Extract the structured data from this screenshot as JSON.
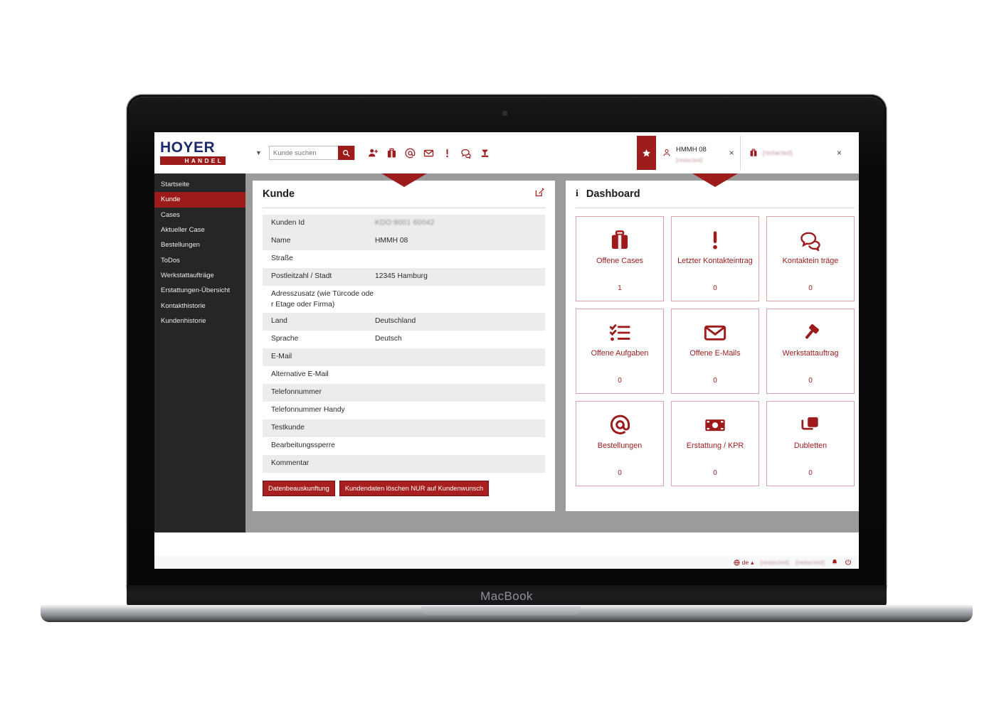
{
  "device": {
    "label": "MacBook"
  },
  "header": {
    "logo_primary": "HOYER",
    "logo_secondary": "HANDEL",
    "search": {
      "placeholder": "Kunde suchen",
      "value": ""
    },
    "icons": [
      "add-user-icon",
      "briefcase-icon",
      "at-sign-icon",
      "envelope-icon",
      "exclamation-icon",
      "chat-bubbles-icon",
      "gavel-icon"
    ],
    "tabs": [
      {
        "starred": true,
        "icon": "person-icon",
        "title": "HMMH 08",
        "subtitle": "[redacted]",
        "close": "×"
      },
      {
        "starred": false,
        "icon": "briefcase-icon",
        "title": "[redacted]",
        "subtitle": "",
        "close": "×"
      }
    ]
  },
  "sidebar": {
    "items": [
      {
        "label": "Startseite",
        "active": false
      },
      {
        "label": "Kunde",
        "active": true
      },
      {
        "label": "Cases",
        "active": false
      },
      {
        "label": "Aktueller Case",
        "active": false
      },
      {
        "label": "Bestellungen",
        "active": false
      },
      {
        "label": "ToDos",
        "active": false
      },
      {
        "label": "Werkstattaufträge",
        "active": false
      },
      {
        "label": "Erstattungen-Übersicht",
        "active": false
      },
      {
        "label": "Kontakthistorie",
        "active": false
      },
      {
        "label": "Kundenhistorie",
        "active": false
      }
    ]
  },
  "kunde_panel": {
    "title": "Kunde",
    "edit_icon": "edit-pencil-icon",
    "fields": [
      {
        "label": "Kunden Id",
        "value": "KDO:8001 60042",
        "blurred": true
      },
      {
        "label": "Name",
        "value": "HMMH 08",
        "blurred": false
      },
      {
        "label": "Straße",
        "value": "",
        "blurred": false
      },
      {
        "label": "Postleitzahl / Stadt",
        "value": "12345 Hamburg",
        "blurred": false
      },
      {
        "label": "Adresszusatz (wie Türcode ode r Etage oder Firma)",
        "value": "",
        "blurred": false
      },
      {
        "label": "Land",
        "value": "Deutschland",
        "blurred": false
      },
      {
        "label": "Sprache",
        "value": "Deutsch",
        "blurred": false
      },
      {
        "label": "E-Mail",
        "value": "",
        "blurred": false
      },
      {
        "label": "Alternative E-Mail",
        "value": "",
        "blurred": false
      },
      {
        "label": "Telefonnummer",
        "value": "",
        "blurred": false
      },
      {
        "label": "Telefonnummer Handy",
        "value": "",
        "blurred": false
      },
      {
        "label": "Testkunde",
        "value": "",
        "blurred": false
      },
      {
        "label": "Bearbeitungssperre",
        "value": "",
        "blurred": false
      },
      {
        "label": "Kommentar",
        "value": "",
        "blurred": false
      }
    ],
    "buttons": [
      {
        "label": "Datenbeauskunftung"
      },
      {
        "label": "Kundendaten löschen NUR auf Kundenwunsch"
      }
    ]
  },
  "dashboard_panel": {
    "title": "Dashboard",
    "info_icon": "info-icon",
    "tiles": [
      {
        "icon": "briefcase-icon",
        "label": "Offene Cases",
        "value": "1"
      },
      {
        "icon": "exclamation-icon",
        "label": "Letzter Kontakteintrag",
        "value": "0"
      },
      {
        "icon": "chat-bubbles-icon",
        "label": "Kontaktein träge",
        "value": "0"
      },
      {
        "icon": "checklist-icon",
        "label": "Offene Aufgaben",
        "value": "0"
      },
      {
        "icon": "envelope-icon",
        "label": "Offene E-Mails",
        "value": "0"
      },
      {
        "icon": "gavel-icon",
        "label": "Werkstattauftrag",
        "value": "0"
      },
      {
        "icon": "at-sign-icon",
        "label": "Bestellungen",
        "value": "0"
      },
      {
        "icon": "banknote-icon",
        "label": "Erstattung / KPR",
        "value": "0"
      },
      {
        "icon": "copy-icon",
        "label": "Dubletten",
        "value": "0"
      }
    ]
  },
  "footer": {
    "globe_icon": "globe-icon",
    "language": "de",
    "caret": "▴",
    "blurred_1": "[redacted]",
    "blurred_2": "[redacted]",
    "bell_icon": "bell-icon",
    "power_icon": "power-icon"
  },
  "colors": {
    "brand_red": "#9e1b1b",
    "brand_navy": "#1c2a6b",
    "sidebar_bg": "#262626",
    "content_bg": "#9b9b9b",
    "tile_border": "#e0a4a4"
  }
}
